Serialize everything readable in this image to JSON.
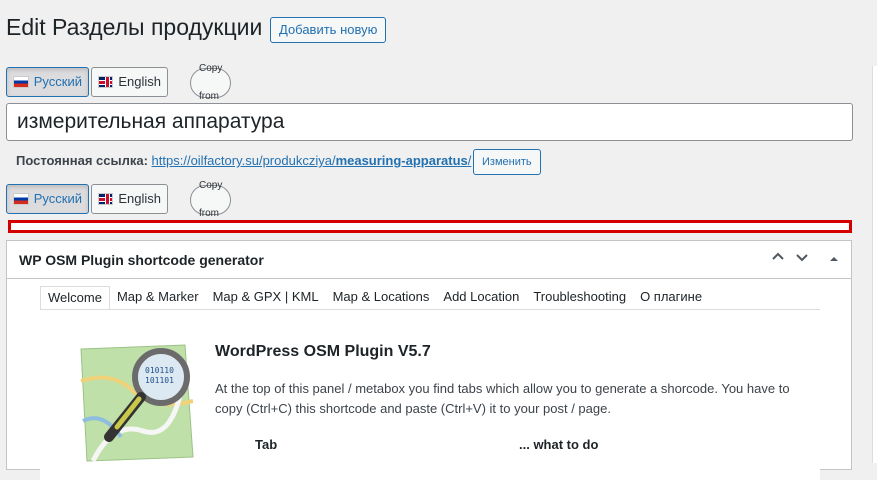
{
  "page": {
    "title": "Edit Разделы продукции",
    "add_new": "Добавить новую"
  },
  "lang_bar_top": {
    "russian": "Русский",
    "english": "English",
    "copy_from": "Copy from"
  },
  "title_field": {
    "value": "измерительная аппаратура"
  },
  "permalink": {
    "label": "Постоянная ссылка:",
    "url_base": "https://oilfactory.su/produkcziya/",
    "url_slug": "measuring-apparatus",
    "url_end": "/",
    "edit_label": "Изменить"
  },
  "lang_bar_bottom": {
    "russian": "Русский",
    "english": "English",
    "copy_from": "Copy from"
  },
  "metabox": {
    "title": "WP OSM Plugin shortcode generator",
    "tabs": [
      "Welcome",
      "Map & Marker",
      "Map & GPX | KML",
      "Map & Locations",
      "Add Location",
      "Troubleshooting",
      "О плагине"
    ],
    "heading": "WordPress OSM Plugin V5.7",
    "intro": "At the top of this panel / metabox you find tabs which allow you to generate a shorcode. You have to copy (Ctrl+C) this shortcode and paste (Ctrl+V) it to your post / page.",
    "col_tab": "Tab",
    "col_what": "... what to do"
  },
  "colors": {
    "accent": "#2271b1",
    "highlight_border": "#d40000"
  }
}
